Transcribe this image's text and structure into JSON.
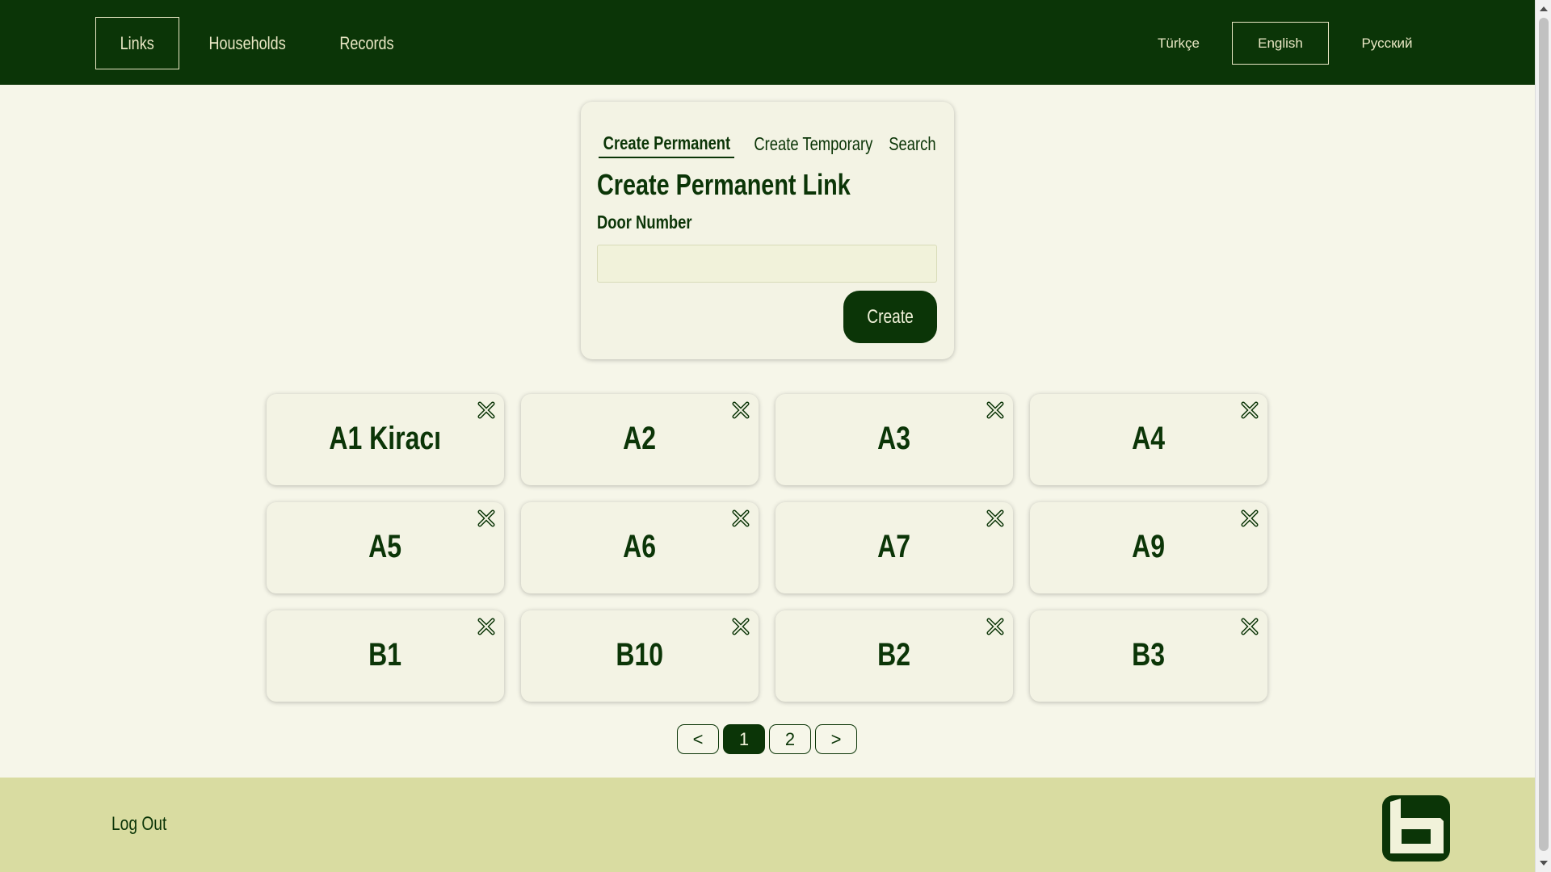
{
  "nav": {
    "items": [
      {
        "label": "Links",
        "active": true
      },
      {
        "label": "Households",
        "active": false
      },
      {
        "label": "Records",
        "active": false
      }
    ]
  },
  "languages": [
    {
      "label": "Türkçe",
      "active": false
    },
    {
      "label": "English",
      "active": true
    },
    {
      "label": "Русский",
      "active": false
    }
  ],
  "form": {
    "tabs": [
      {
        "label": "Create Permanent",
        "active": true
      },
      {
        "label": "Create Temporary",
        "active": false
      },
      {
        "label": "Search",
        "active": false
      }
    ],
    "title": "Create Permanent Link",
    "field_label": "Door Number",
    "field_value": "",
    "field_placeholder": "",
    "submit_label": "Create"
  },
  "links": [
    {
      "name": "A1 Kiracı"
    },
    {
      "name": "A2"
    },
    {
      "name": "A3"
    },
    {
      "name": "A4"
    },
    {
      "name": "A5"
    },
    {
      "name": "A6"
    },
    {
      "name": "A7"
    },
    {
      "name": "A9"
    },
    {
      "name": "B1"
    },
    {
      "name": "B10"
    },
    {
      "name": "B2"
    },
    {
      "name": "B3"
    }
  ],
  "pagination": {
    "prev_label": "<",
    "pages": [
      "1",
      "2"
    ],
    "current_page": "1",
    "next_label": ">"
  },
  "footer": {
    "logout_label": "Log Out",
    "logo_icon": "brand-b-logo-icon"
  },
  "colors": {
    "primary": "#0b3507",
    "background": "#f6f6e9",
    "card": "#f3f3e4",
    "footer": "#d9dca1",
    "accent_text": "#e9e7c4"
  }
}
